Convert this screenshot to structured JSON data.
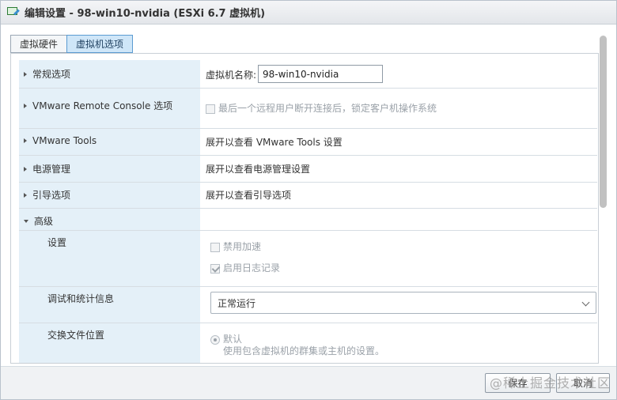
{
  "window": {
    "title": "编辑设置 - 98-win10-nvidia (ESXi 6.7 虚拟机)"
  },
  "tabs": [
    {
      "label": "虚拟硬件",
      "active": false
    },
    {
      "label": "虚拟机选项",
      "active": true
    }
  ],
  "rows": {
    "general": {
      "label": "常规选项",
      "field_label": "虚拟机名称:",
      "field_value": "98-win10-nvidia"
    },
    "vmrc": {
      "label": "VMware Remote Console 选项",
      "checkbox_label": "最后一个远程用户断开连接后，锁定客户机操作系统"
    },
    "tools": {
      "label": "VMware Tools",
      "value": "展开以查看 VMware Tools 设置"
    },
    "power": {
      "label": "电源管理",
      "value": "展开以查看电源管理设置"
    },
    "boot": {
      "label": "引导选项",
      "value": "展开以查看引导选项"
    },
    "advanced": {
      "label": "高级"
    },
    "settings": {
      "label": "设置",
      "disable_accel": "禁用加速",
      "enable_logging": "启用日志记录"
    },
    "debug": {
      "label": "调试和统计信息",
      "selected": "正常运行"
    },
    "swap": {
      "label": "交换文件位置",
      "default_label": "默认",
      "default_desc": "使用包含虚拟机的群集或主机的设置。"
    }
  },
  "footer": {
    "save_label": "保存",
    "cancel_label": "取消"
  },
  "watermark": "@稀土掘金技术社区",
  "colors": {
    "accent": "#cfe6f8",
    "label_column": "#e4f0f8"
  }
}
